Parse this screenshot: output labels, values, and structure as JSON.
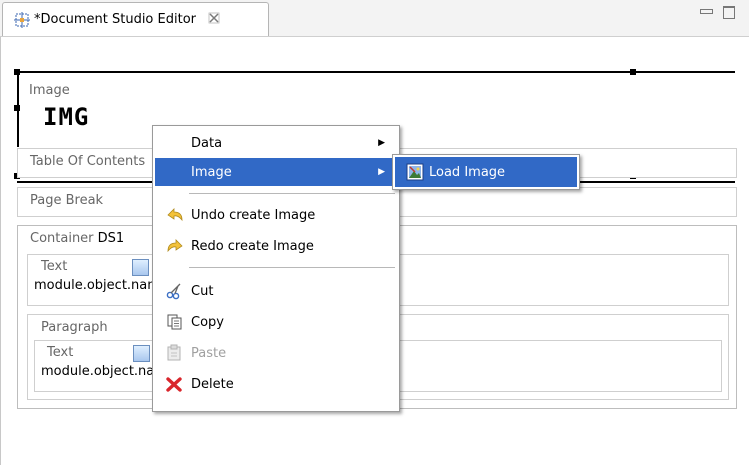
{
  "tab": {
    "title": "*Document Studio Editor",
    "icon": "report-editor-icon",
    "close_icon": "close-icon"
  },
  "window_controls": {
    "minimize_icon": "minimize-icon",
    "maximize_icon": "maximize-icon"
  },
  "editor": {
    "image_block": {
      "label": "Image",
      "content": "IMG"
    },
    "toc_block": {
      "label": "Table Of Contents"
    },
    "page_break_block": {
      "label": "Page Break"
    },
    "container_block": {
      "label": "Container",
      "name": "DS1",
      "text_block": {
        "label": "Text",
        "value": "module.object.name"
      },
      "paragraph_block": {
        "label": "Paragraph",
        "text_block": {
          "label": "Text",
          "value": "module.object.name"
        }
      }
    }
  },
  "context_menu": {
    "items": [
      {
        "label": "Data",
        "has_submenu": true
      },
      {
        "label": "Image",
        "has_submenu": true,
        "highlighted": true
      },
      {
        "label": "Undo create Image",
        "icon": "undo-icon"
      },
      {
        "label": "Redo create Image",
        "icon": "redo-icon"
      },
      {
        "label": "Cut",
        "icon": "scissors-icon"
      },
      {
        "label": "Copy",
        "icon": "copy-icon"
      },
      {
        "label": "Paste",
        "icon": "paste-icon",
        "disabled": true
      },
      {
        "label": "Delete",
        "icon": "delete-icon"
      }
    ],
    "submenu": {
      "items": [
        {
          "label": "Load Image",
          "icon": "load-image-icon",
          "highlighted": true
        }
      ]
    }
  },
  "colors": {
    "highlight": "#3169c6",
    "delete_red": "#d9262c",
    "undo_yellow": "#f3c23a"
  }
}
